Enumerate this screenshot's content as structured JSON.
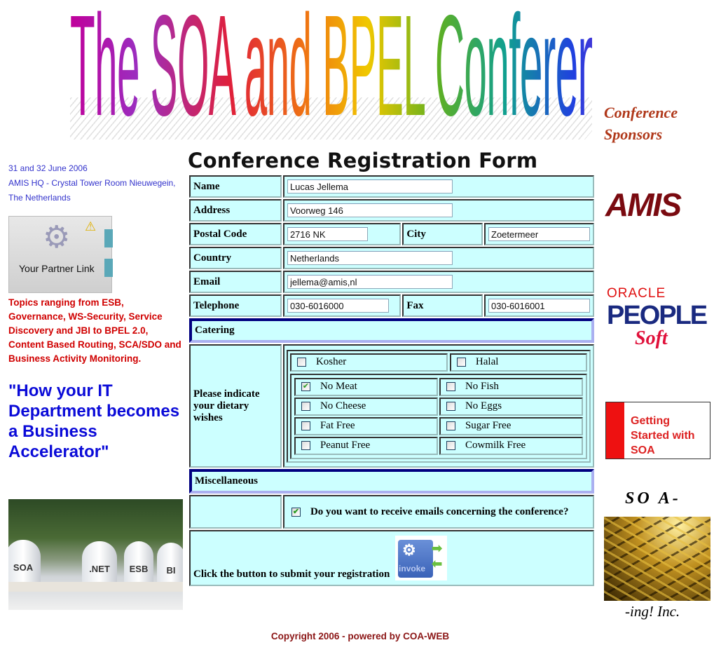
{
  "banner": {
    "title": "The SOA and BPEL Conference"
  },
  "left": {
    "date": "31 and 32 June 2006",
    "location": "AMIS HQ - Crystal Tower Room Nieuwegein, The Netherlands",
    "partner_link_label": "Your Partner Link",
    "topics": "Topics ranging from ESB, Governance, WS-Security, Service Discovery and JBI to BPEL 2.0, Content Based Routing, SCA/SDO and Business Activity Monitoring.",
    "quote": "\"How your IT Department becomes a Business Accelerator\"",
    "mailbox_labels": [
      "SOA",
      ".NET",
      "ESB",
      "BI"
    ]
  },
  "form": {
    "title": "Conference Registration Form",
    "name_label": "Name",
    "name_value": "Lucas Jellema",
    "address_label": "Address",
    "address_value": "Voorweg 146",
    "postal_label": "Postal Code",
    "postal_value": "2716 NK",
    "city_label": "City",
    "city_value": "Zoetermeer",
    "country_label": "Country",
    "country_value": "Netherlands",
    "email_label": "Email",
    "email_value": "jellema@amis,nl",
    "telephone_label": "Telephone",
    "telephone_value": "030-6016000",
    "fax_label": "Fax",
    "fax_value": "030-6016001",
    "catering_header": "Catering",
    "dietary_label": "Please indicate your dietary wishes",
    "religious": [
      {
        "label": "Kosher",
        "checked": false
      },
      {
        "label": "Halal",
        "checked": false
      }
    ],
    "diet_options": [
      {
        "label": "No Meat",
        "checked": true
      },
      {
        "label": "No Fish",
        "checked": false
      },
      {
        "label": "No Cheese",
        "checked": false
      },
      {
        "label": "No Eggs",
        "checked": false
      },
      {
        "label": "Fat Free",
        "checked": false
      },
      {
        "label": "Sugar Free",
        "checked": false
      },
      {
        "label": "Peanut Free",
        "checked": false
      },
      {
        "label": "Cowmilk Free",
        "checked": false
      }
    ],
    "misc_header": "Miscellaneous",
    "emails_label": "Do you want to receive emails concerning the conference?",
    "emails_checked": true,
    "submit_label": "Click the button to submit your registration",
    "invoke_label": "invoke"
  },
  "sponsors": {
    "title": "Conference Sponsors",
    "amis": "AMIS",
    "oracle": "ORACLE",
    "peoplesoft": "PEOPLE",
    "peoplesoft_soft": "Soft",
    "getting_started": "Getting Started with SOA",
    "soa_top": "SO A-",
    "soa_bottom": "-ing! Inc."
  },
  "footer": {
    "copyright": "Copyright 2006 - powered by COA-WEB"
  },
  "colors": {
    "form_bg": "#ccffff",
    "section_border": "#000080",
    "topics": "#d00000",
    "quote": "#0a0ad8",
    "sponsors": "#b0381a",
    "footer": "#8b1515"
  }
}
